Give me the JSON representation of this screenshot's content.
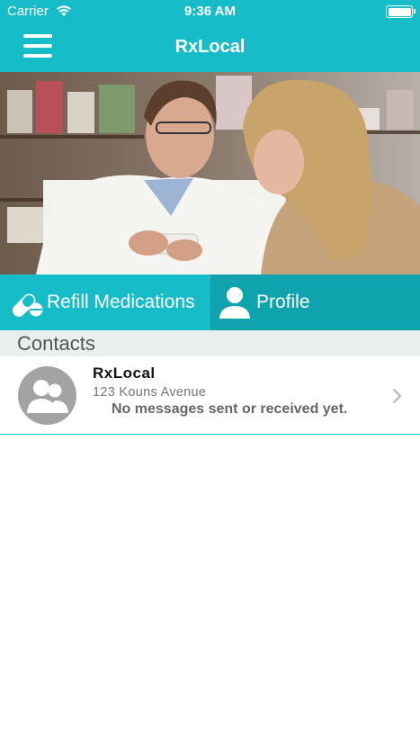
{
  "status_bar": {
    "carrier": "Carrier",
    "time": "9:36 AM",
    "battery_level": 1.0
  },
  "nav_bar": {
    "title": "RxLocal",
    "menu_icon": "hamburger-menu-icon",
    "background_color": "#17bcc9"
  },
  "hero_image": {
    "description_icon": "pharmacist-photo"
  },
  "actions": {
    "refill": {
      "label": "Refill Medications",
      "icon": "pill-capsule-icon",
      "color": "#17bcc9"
    },
    "profile": {
      "label": "Profile",
      "icon": "person-icon",
      "color": "#0fa3ad"
    }
  },
  "contacts": {
    "header": "Contacts",
    "items": [
      {
        "name": "RxLocal",
        "address": "123 Kouns Avenue",
        "last_message": "No messages sent or received yet.",
        "avatar_icon": "group-avatar-icon"
      }
    ]
  }
}
